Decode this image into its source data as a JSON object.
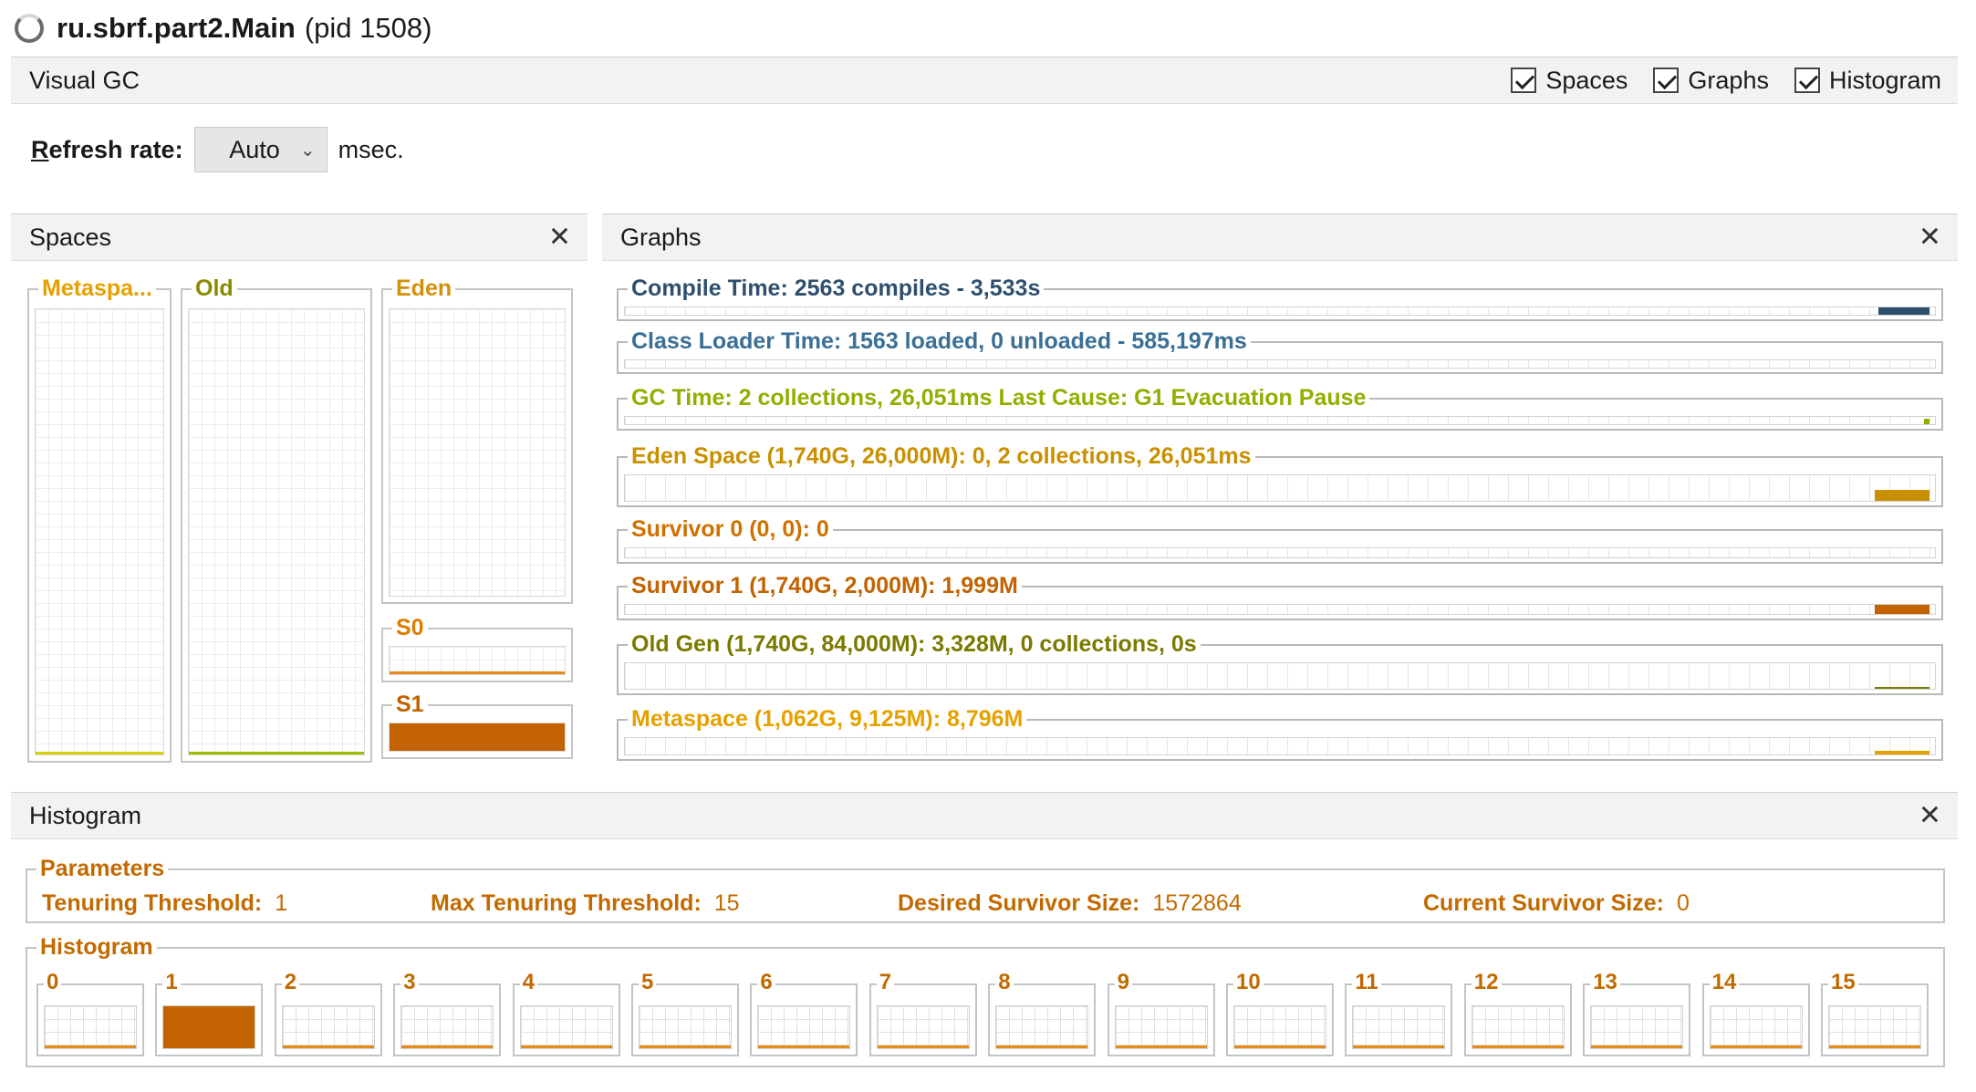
{
  "window": {
    "title": "ru.sbrf.part2.Main",
    "pid": "(pid 1508)"
  },
  "visual_gc": {
    "label": "Visual GC",
    "checkboxes": [
      {
        "label": "Spaces",
        "checked": true
      },
      {
        "label": "Graphs",
        "checked": true
      },
      {
        "label": "Histogram",
        "checked": true
      }
    ]
  },
  "refresh": {
    "label_first": "R",
    "label_rest": "efresh rate:",
    "value": "Auto",
    "unit": "msec."
  },
  "spaces": {
    "title": "Spaces",
    "metaspace": {
      "label": "Metaspa...",
      "color": "#e6a100",
      "fill": 0.01
    },
    "old": {
      "label": "Old",
      "color": "#8a8a00",
      "fill": 0.01
    },
    "eden": {
      "label": "Eden",
      "color": "#d4900a",
      "fill": 0.0
    },
    "s0": {
      "label": "S0",
      "color": "#e07b00",
      "fill": 0.0
    },
    "s1": {
      "label": "S1",
      "color": "#c26200",
      "fill": 1.0
    }
  },
  "graphs": {
    "title": "Graphs",
    "rows": [
      {
        "label": "Compile Time: 2563 compiles - 3,533s",
        "color": "#2f4f6f"
      },
      {
        "label": "Class Loader Time: 1563 loaded, 0 unloaded - 585,197ms",
        "color": "#3a6f96"
      },
      {
        "label": "GC Time: 2 collections, 26,051ms Last Cause: G1 Evacuation Pause",
        "color": "#8fb000"
      },
      {
        "label": "Eden Space (1,740G, 26,000M): 0, 2 collections, 26,051ms",
        "color": "#c99000"
      },
      {
        "label": "Survivor 0 (0, 0): 0",
        "color": "#d07000"
      },
      {
        "label": "Survivor 1 (1,740G, 2,000M): 1,999M",
        "color": "#c26200"
      },
      {
        "label": "Old Gen (1,740G, 84,000M): 3,328M, 0 collections, 0s",
        "color": "#7a7a00"
      },
      {
        "label": "Metaspace (1,062G, 9,125M): 8,796M",
        "color": "#e6a100"
      }
    ]
  },
  "histogram": {
    "title": "Histogram",
    "parameters_label": "Parameters",
    "params": [
      {
        "key": "Tenuring Threshold:",
        "value": "1"
      },
      {
        "key": "Max Tenuring Threshold:",
        "value": "15"
      },
      {
        "key": "Desired Survivor Size:",
        "value": "1572864"
      },
      {
        "key": "Current Survivor Size:",
        "value": "0"
      }
    ],
    "histogram_label": "Histogram",
    "ages": [
      {
        "label": "0",
        "fill": 0.0
      },
      {
        "label": "1",
        "fill": 1.0
      },
      {
        "label": "2",
        "fill": 0.0
      },
      {
        "label": "3",
        "fill": 0.0
      },
      {
        "label": "4",
        "fill": 0.0
      },
      {
        "label": "5",
        "fill": 0.0
      },
      {
        "label": "6",
        "fill": 0.0
      },
      {
        "label": "7",
        "fill": 0.0
      },
      {
        "label": "8",
        "fill": 0.0
      },
      {
        "label": "9",
        "fill": 0.0
      },
      {
        "label": "10",
        "fill": 0.0
      },
      {
        "label": "11",
        "fill": 0.0
      },
      {
        "label": "12",
        "fill": 0.0
      },
      {
        "label": "13",
        "fill": 0.0
      },
      {
        "label": "14",
        "fill": 0.0
      },
      {
        "label": "15",
        "fill": 0.0
      }
    ]
  },
  "icons": {
    "loading": "loading-spinner-icon",
    "close": "close-icon",
    "dropdown": "chevron-down-icon"
  }
}
